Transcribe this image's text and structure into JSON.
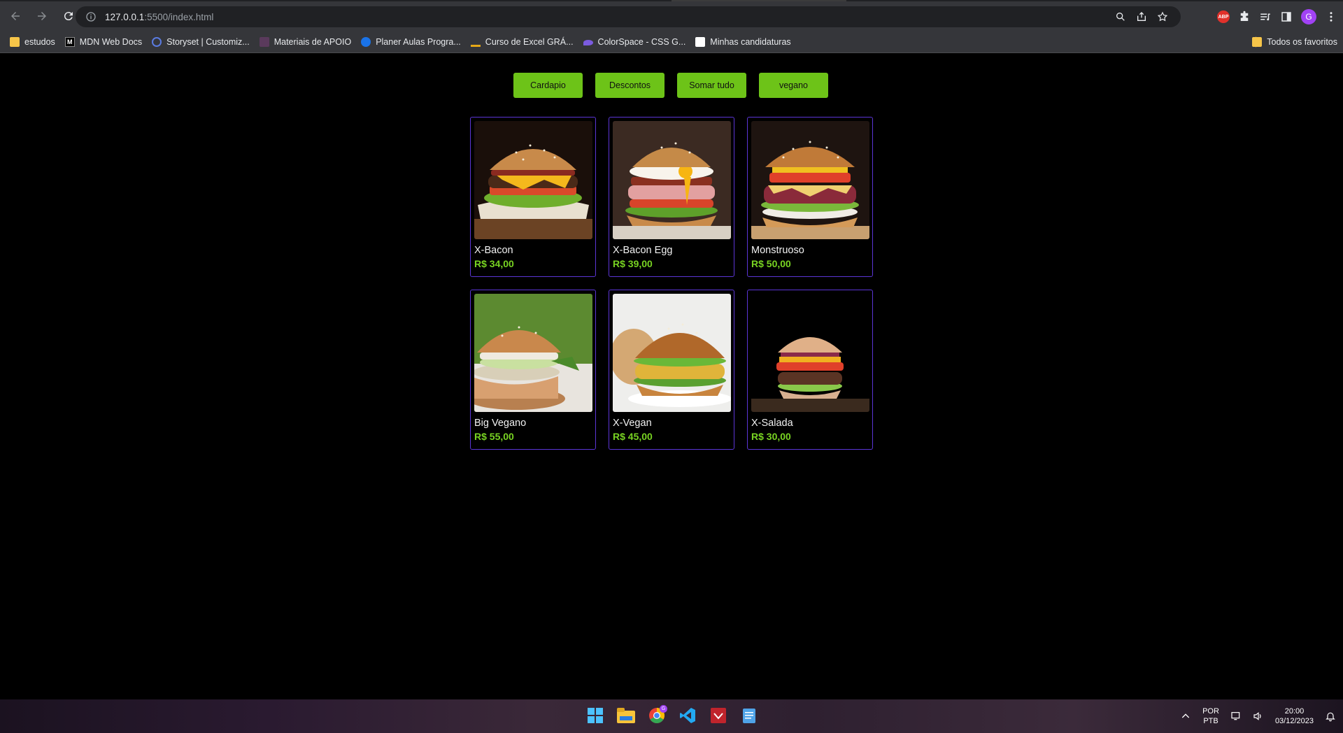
{
  "browser": {
    "url_host": "127.0.0.1",
    "url_rest": ":5500/index.html",
    "abp_label": "ABP",
    "profile_initial": "G",
    "bookmarks": [
      {
        "label": "estudos",
        "icon": "folder-icon"
      },
      {
        "label": "MDN Web Docs",
        "icon": "mdn-icon"
      },
      {
        "label": "Storyset | Customiz...",
        "icon": "storyset-icon"
      },
      {
        "label": "Materiais de APOIO",
        "icon": "apoio-icon"
      },
      {
        "label": "Planer Aulas Progra...",
        "icon": "planer-icon"
      },
      {
        "label": "Curso de Excel GRÁ...",
        "icon": "excel-course-icon"
      },
      {
        "label": "ColorSpace - CSS G...",
        "icon": "colorspace-icon"
      },
      {
        "label": "Minhas candidaturas",
        "icon": "candidaturas-icon"
      }
    ],
    "all_bookmarks": "Todos os favoritos"
  },
  "actions": {
    "cardapio": "Cardapio",
    "descontos": "Descontos",
    "somar": "Somar tudo",
    "vegano": "vegano"
  },
  "products": [
    {
      "name": "X-Bacon",
      "price": "R$ 34,00"
    },
    {
      "name": "X-Bacon Egg",
      "price": "R$ 39,00"
    },
    {
      "name": "Monstruoso",
      "price": "R$ 50,00"
    },
    {
      "name": "Big Vegano",
      "price": "R$ 55,00"
    },
    {
      "name": "X-Vegan",
      "price": "R$ 45,00"
    },
    {
      "name": "X-Salada",
      "price": "R$ 30,00"
    }
  ],
  "taskbar": {
    "lang1": "POR",
    "lang2": "PTB",
    "time": "20:00",
    "date": "03/12/2023",
    "chrome_badge": "G"
  },
  "colors": {
    "accent_green": "#6dc318",
    "card_border": "#5b35d6",
    "price_green": "#78d322"
  }
}
